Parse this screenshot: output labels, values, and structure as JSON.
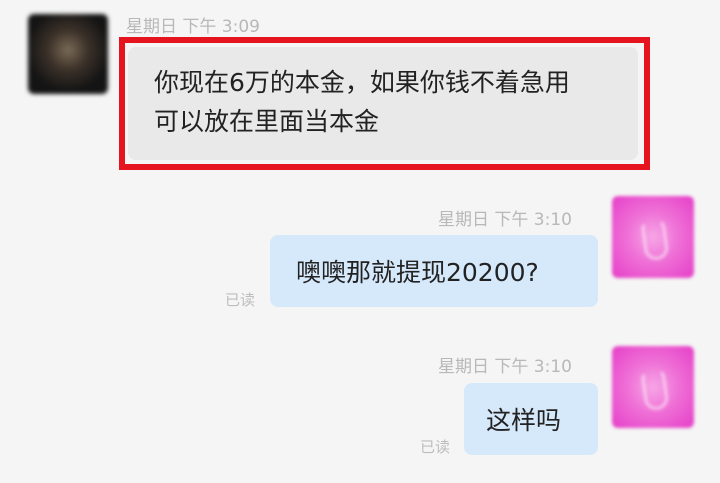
{
  "messages": [
    {
      "side": "left",
      "timestamp": "星期日 下午 3:09",
      "lines": [
        "你现在6万的本金，如果你钱不着急用",
        "可以放在里面当本金"
      ],
      "highlighted": true,
      "highlight_color": "#e5141e"
    },
    {
      "side": "right",
      "timestamp": "星期日 下午 3:10",
      "text": "噢噢那就提现20200?",
      "read_label": "已读"
    },
    {
      "side": "right",
      "timestamp": "星期日 下午 3:10",
      "text": "这样吗",
      "read_label": "已读"
    }
  ],
  "colors": {
    "background": "#f5f5f5",
    "incoming_bubble": "#e9e9e9",
    "outgoing_bubble": "#d6e9fb",
    "timestamp_text": "#b8b8b8"
  }
}
